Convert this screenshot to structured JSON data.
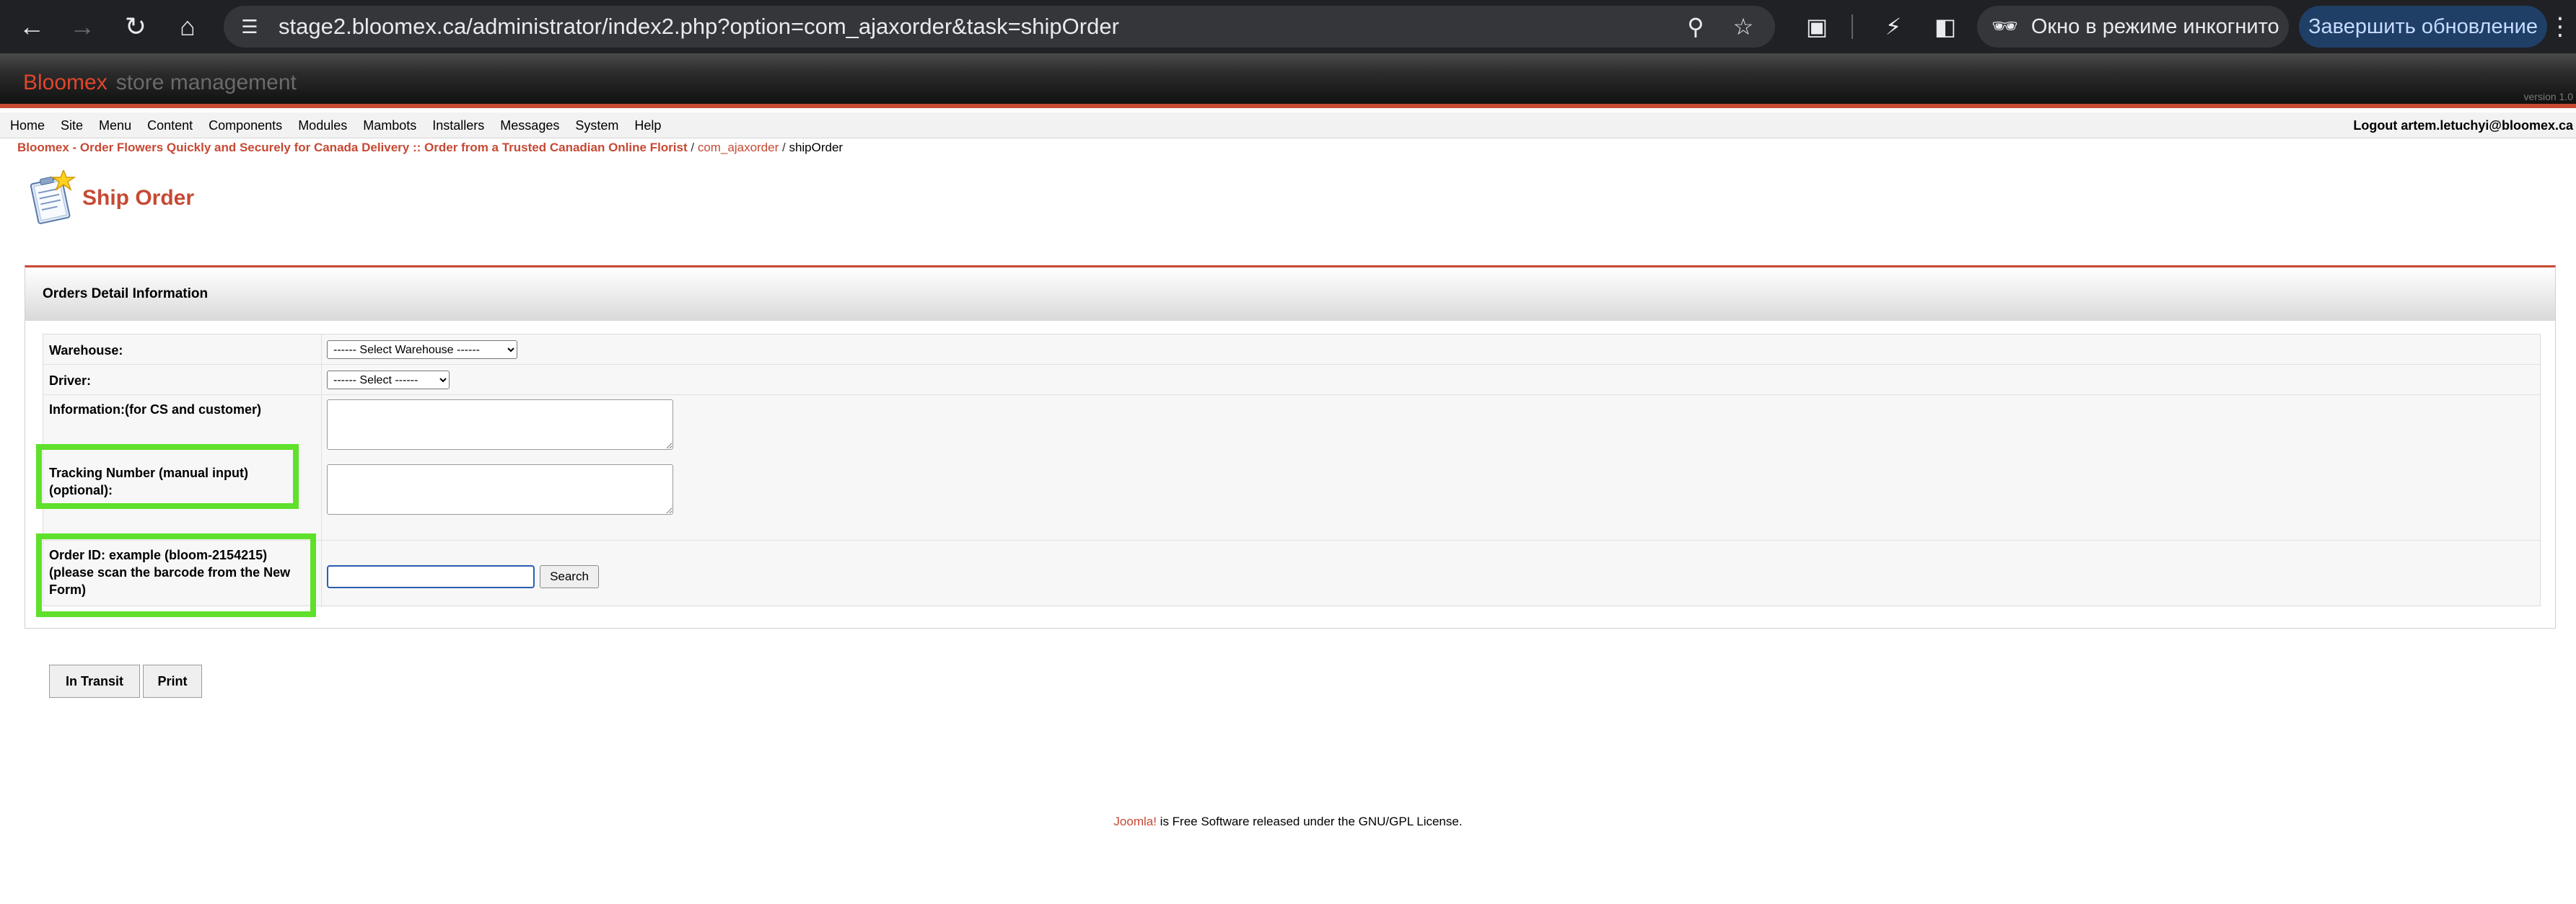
{
  "browser": {
    "url": "stage2.bloomex.ca/administrator/index2.php?option=com_ajaxorder&task=shipOrder",
    "incognito_label": "Окно в режиме инкогнито",
    "update_label": "Завершить обновление"
  },
  "header": {
    "brand_primary": "Bloomex",
    "brand_secondary": "store management",
    "version": "version 1.0"
  },
  "menu": {
    "items": [
      "Home",
      "Site",
      "Menu",
      "Content",
      "Components",
      "Modules",
      "Mambots",
      "Installers",
      "Messages",
      "System",
      "Help"
    ],
    "logout": "Logout artem.letuchyi@bloomex.ca"
  },
  "breadcrumb": {
    "site": "Bloomex - Order Flowers Quickly and Securely for Canada Delivery :: Order from a Trusted Canadian Online Florist",
    "sep1": " / ",
    "component": "com_ajaxorder",
    "sep2": " / ",
    "task": "shipOrder"
  },
  "page": {
    "title": "Ship Order"
  },
  "panel": {
    "title": "Orders Detail Information",
    "warehouse_label": "Warehouse:",
    "warehouse_selected": "------ Select Warehouse ------",
    "driver_label": "Driver:",
    "driver_selected": "------ Select ------",
    "info_label": "Information:(for CS and customer)",
    "tracking_label_line1": "Tracking Number (manual input)",
    "tracking_label_line2": "(optional):",
    "order_label_line1": "Order ID: example (bloom-2154215)",
    "order_label_line2": "(please scan the barcode from the New",
    "order_label_line3": "Form)",
    "search_button": "Search"
  },
  "actions": {
    "in_transit": "In Transit",
    "print": "Print"
  },
  "footer": {
    "joomla": "Joomla!",
    "text": " is Free Software released under the GNU/GPL License."
  },
  "colors": {
    "accent": "#c64934",
    "highlight": "#5fe02b",
    "chrome_bg": "#202124"
  }
}
